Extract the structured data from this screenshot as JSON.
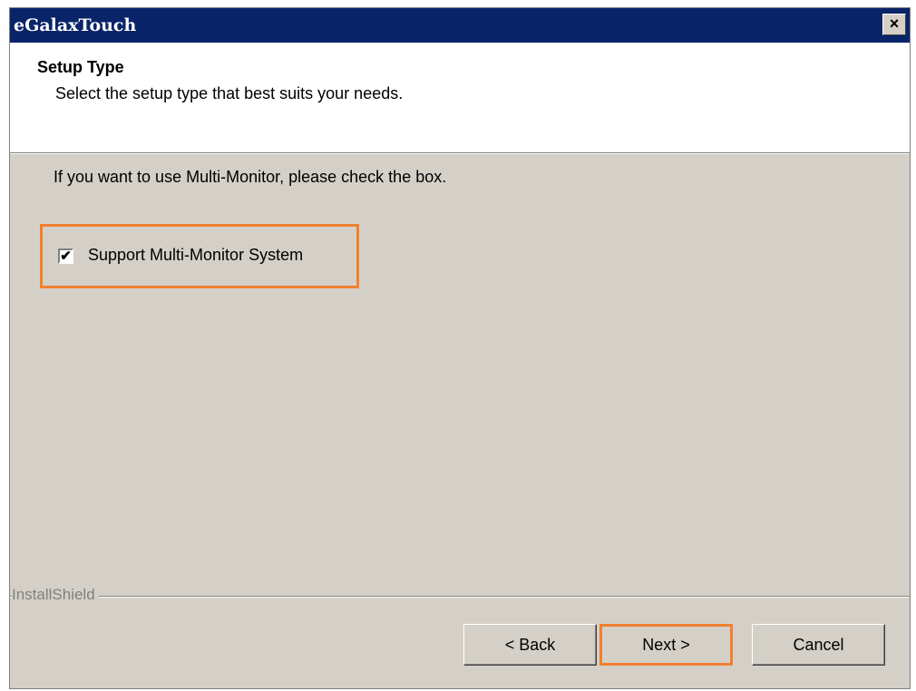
{
  "window": {
    "title": "eGalaxTouch",
    "close_glyph": "×",
    "close_icon": "close-icon"
  },
  "header": {
    "title": "Setup Type",
    "subtitle": "Select the setup type that best suits your needs."
  },
  "body": {
    "instruction": "If you want to use Multi-Monitor, please check the box.",
    "checkbox": {
      "label": "Support Multi-Monitor System",
      "checked": true,
      "check_glyph": "✔"
    }
  },
  "footer": {
    "brand": "InstallShield",
    "buttons": {
      "back": "< Back",
      "next": "Next >",
      "cancel": "Cancel"
    }
  },
  "colors": {
    "titlebar": "#0a246a",
    "dialog": "#d4d0c8",
    "highlight": "#f08030"
  }
}
